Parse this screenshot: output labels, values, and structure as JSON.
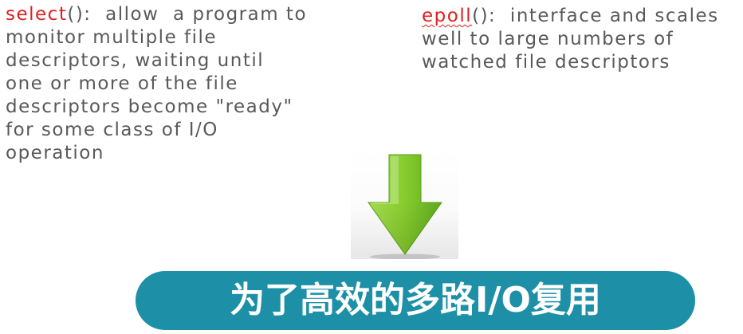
{
  "select_block": {
    "keyword": "select",
    "first_line_rest": "():  allow  a program to",
    "lines": [
      "monitor multiple file",
      "descriptors, waiting until",
      "one or more of the file",
      "descriptors become \"ready\"",
      "for some class of I/O",
      "operation"
    ]
  },
  "epoll_block": {
    "keyword": "epoll",
    "first_line_rest": "():  interface and scales",
    "lines": [
      "well to large numbers of",
      "watched file descriptors"
    ]
  },
  "arrow": {
    "icon": "down-arrow-icon",
    "color": "#7cc430"
  },
  "banner": {
    "text": "为了高效的多路I/O复用",
    "color": "#1d8fa6"
  },
  "colors": {
    "body_text": "#595959",
    "keyword": "#e02020"
  }
}
